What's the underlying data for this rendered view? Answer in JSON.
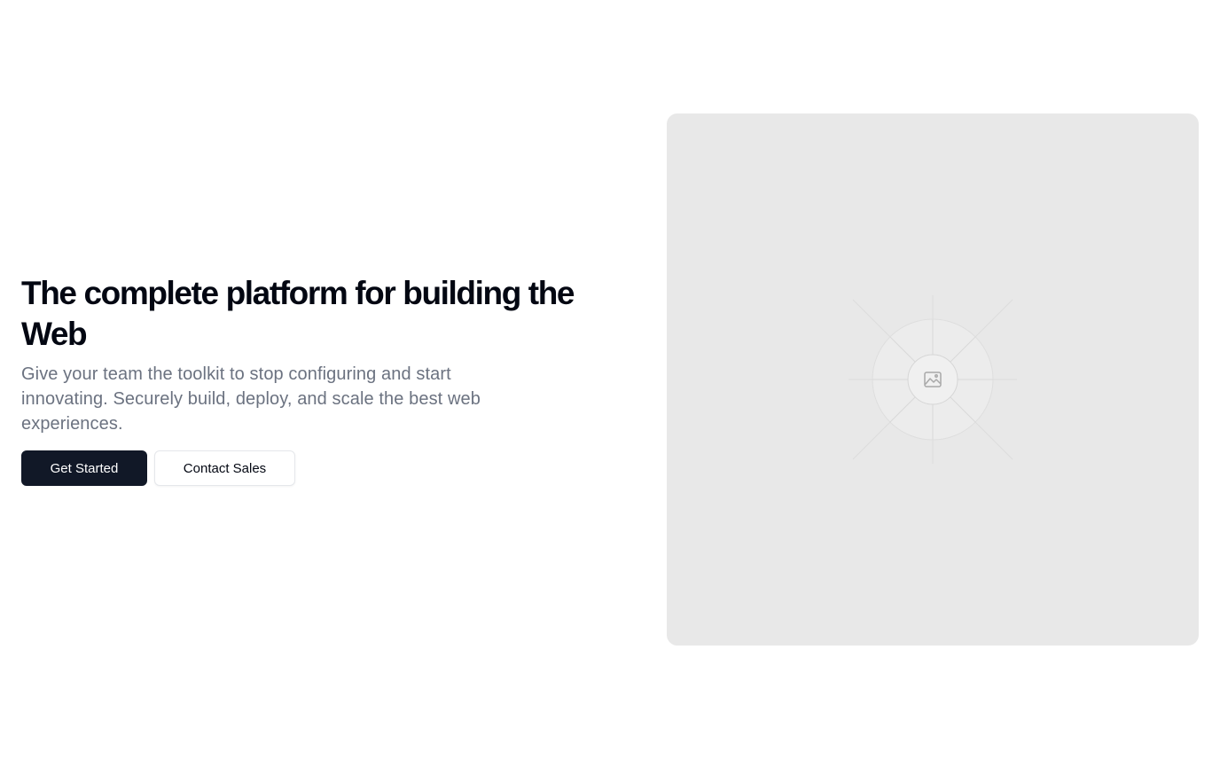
{
  "hero": {
    "title": "The complete platform for building the Web",
    "subtitle": "Give your team the toolkit to stop configuring and start innovating. Securely build, deploy, and scale the best web experiences.",
    "primary_button": "Get Started",
    "secondary_button": "Contact Sales",
    "image_icon": "image-placeholder-icon"
  },
  "colors": {
    "primary_button_bg": "#111827",
    "title_text": "#030712",
    "subtitle_text": "#6b7280",
    "image_placeholder_bg": "#e8e8e8"
  }
}
